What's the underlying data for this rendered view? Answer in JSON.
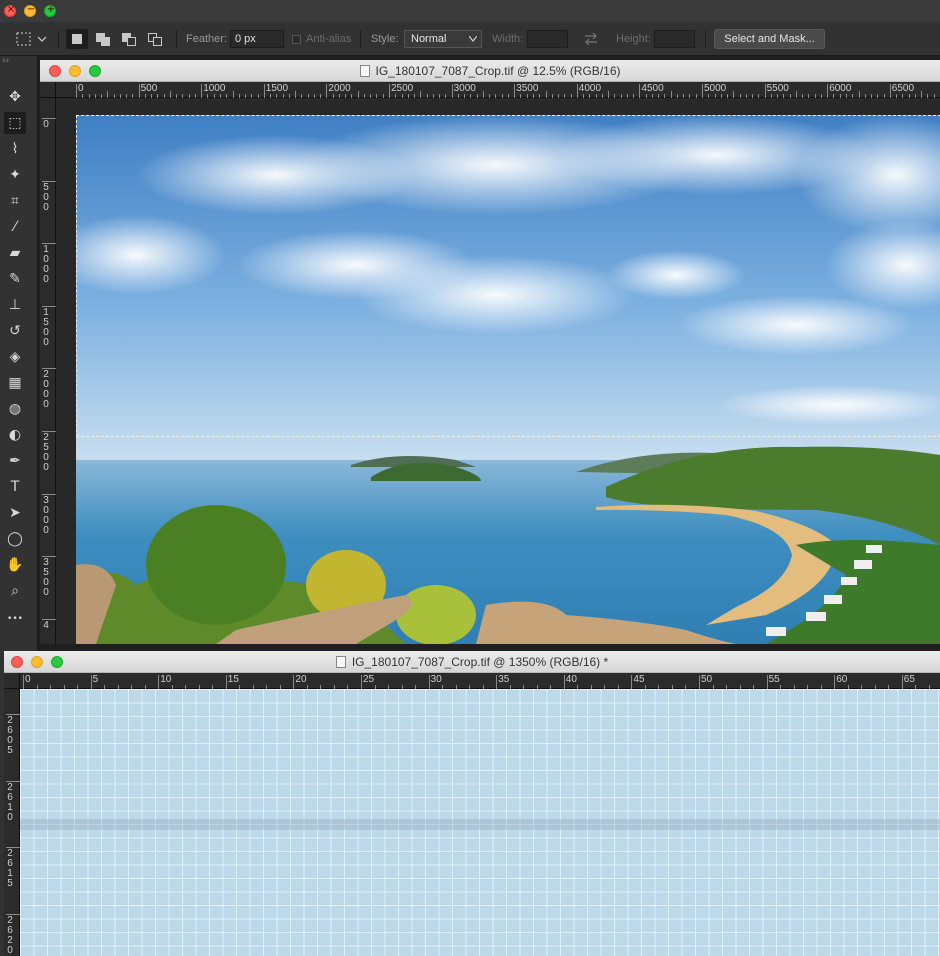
{
  "app": {
    "tool_options": {
      "feather_label": "Feather:",
      "feather_value": "0 px",
      "anti_alias_label": "Anti-alias",
      "style_label": "Style:",
      "style_value": "Normal",
      "width_label": "Width:",
      "height_label": "Height:",
      "select_mask_label": "Select and Mask..."
    },
    "tools": [
      {
        "name": "move-tool",
        "icon": "move-icon",
        "glyph": "✥"
      },
      {
        "name": "marquee-tool",
        "icon": "rect-marquee-icon",
        "glyph": "⬚",
        "active": true
      },
      {
        "name": "lasso-tool",
        "icon": "lasso-icon",
        "glyph": "⌇"
      },
      {
        "name": "magic-wand-tool",
        "icon": "magic-wand-icon",
        "glyph": "✦"
      },
      {
        "name": "crop-tool",
        "icon": "crop-icon",
        "glyph": "⌗"
      },
      {
        "name": "eyedropper-tool",
        "icon": "eyedropper-icon",
        "glyph": "⁄"
      },
      {
        "name": "healing-tool",
        "icon": "bandage-icon",
        "glyph": "▰"
      },
      {
        "name": "brush-tool",
        "icon": "brush-icon",
        "glyph": "✎"
      },
      {
        "name": "stamp-tool",
        "icon": "stamp-icon",
        "glyph": "⊥"
      },
      {
        "name": "history-brush-tool",
        "icon": "history-brush-icon",
        "glyph": "↺"
      },
      {
        "name": "eraser-tool",
        "icon": "eraser-icon",
        "glyph": "◈"
      },
      {
        "name": "gradient-tool",
        "icon": "gradient-icon",
        "glyph": "▦"
      },
      {
        "name": "blur-tool",
        "icon": "blur-icon",
        "glyph": "◍"
      },
      {
        "name": "dodge-tool",
        "icon": "dodge-icon",
        "glyph": "◐"
      },
      {
        "name": "pen-tool",
        "icon": "pen-icon",
        "glyph": "✒"
      },
      {
        "name": "type-tool",
        "icon": "type-icon",
        "glyph": "T"
      },
      {
        "name": "path-select-tool",
        "icon": "arrow-icon",
        "glyph": "➤"
      },
      {
        "name": "shape-tool",
        "icon": "ellipse-icon",
        "glyph": "◯"
      },
      {
        "name": "hand-tool",
        "icon": "hand-icon",
        "glyph": "✋"
      },
      {
        "name": "zoom-tool",
        "icon": "zoom-icon",
        "glyph": "⌕"
      },
      {
        "name": "more-tools",
        "icon": "more-icon",
        "glyph": "•••"
      }
    ]
  },
  "doc1": {
    "title": "IG_180107_7087_Crop.tif @ 12.5% (RGB/16)",
    "ruler_h": [
      "0",
      "500",
      "1000",
      "1500",
      "2000",
      "2500",
      "3000",
      "3500",
      "4000",
      "4500",
      "5000",
      "5500",
      "6000",
      "6500"
    ],
    "ruler_v": [
      "0",
      "5\n0\n0",
      "1\n0\n0\n0",
      "1\n5\n0\n0",
      "2\n0\n0\n0",
      "2\n5\n0\n0",
      "3\n0\n0\n0",
      "3\n5\n0\n0",
      "4"
    ]
  },
  "doc2": {
    "title": "IG_180107_7087_Crop.tif @ 1350% (RGB/16) *",
    "ruler_h": [
      "0",
      "5",
      "10",
      "15",
      "20",
      "25",
      "30",
      "35",
      "40",
      "45",
      "50",
      "55",
      "60",
      "65"
    ],
    "ruler_v": [
      "2\n6\n0\n5",
      "2\n6\n1\n0",
      "2\n6\n1\n5",
      "2\n6\n2\n0"
    ]
  }
}
